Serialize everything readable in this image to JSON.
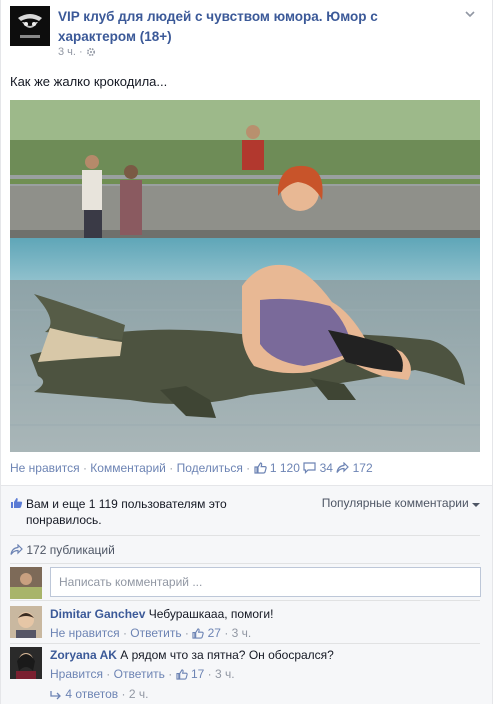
{
  "post": {
    "page_name": "VIP клуб для людей с чувством юмора. Юмор с характером (18+)",
    "time": "3 ч.",
    "audience_icon": "gear-icon",
    "text": "Как же жалко крокодила..."
  },
  "actions": {
    "unlike": "Не нравится",
    "comment": "Комментарий",
    "share": "Поделиться",
    "likes_count": "1 120",
    "comments_count": "34",
    "shares_count": "172"
  },
  "feedback": {
    "likes_text": "Вам и еще 1 119 пользователям это понравилось.",
    "sort_label": "Популярные комментарии",
    "shares_text": "172 публикаций",
    "comment_placeholder": "Написать комментарий ..."
  },
  "comments": [
    {
      "author": "Dimitar Ganchev",
      "text": "Чебурашкааа, помоги!",
      "action": "Не нравится",
      "reply": "Ответить",
      "likes": "27",
      "time": "3 ч."
    },
    {
      "author": "Zoryana AK",
      "text": "А рядом что за пятна? Он обосрался?",
      "action": "Нравится",
      "reply": "Ответить",
      "likes": "17",
      "time": "3 ч.",
      "replies_label": "4 ответов",
      "replies_time": "2 ч."
    }
  ],
  "colors": {
    "link": "#3b5998",
    "action_link": "#6d84b4",
    "meta": "#9197a3",
    "feedback_bg": "#f6f7f9"
  }
}
